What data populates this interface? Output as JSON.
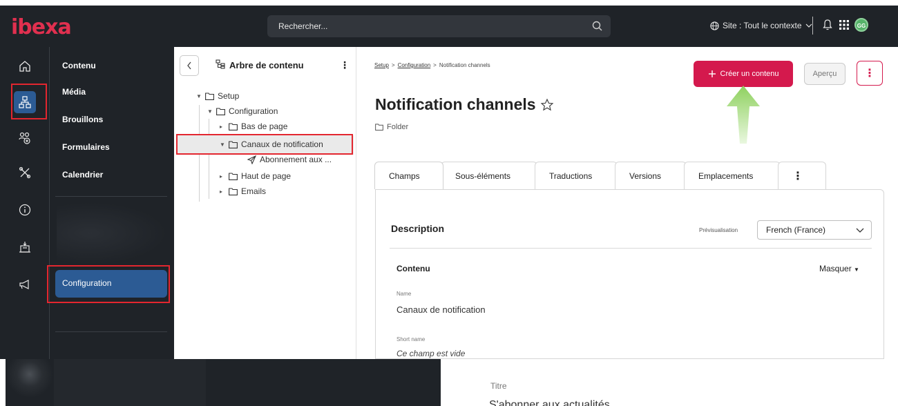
{
  "header": {
    "logo": "ibexa",
    "search_placeholder": "Rechercher...",
    "site_switch": "Site : Tout le contexte",
    "avatar_initials": "GG"
  },
  "nav": {
    "items": [
      "Contenu",
      "Média",
      "Brouillons",
      "Formulaires",
      "Calendrier"
    ],
    "active_item": "Configuration"
  },
  "tree": {
    "title": "Arbre de contenu",
    "nodes": {
      "setup": "Setup",
      "configuration": "Configuration",
      "footer": "Bas de page",
      "notification_channels": "Canaux de notification",
      "subscription": "Abonnement aux ...",
      "header": "Haut de page",
      "emails": "Emails"
    }
  },
  "breadcrumb": {
    "items": [
      "Setup",
      "Configuration",
      "Notification channels"
    ],
    "separator": ">"
  },
  "actions": {
    "create": "Créer un contenu",
    "preview": "Aperçu"
  },
  "page": {
    "title": "Notification channels",
    "content_type": "Folder"
  },
  "tabs": [
    "Champs",
    "Sous-éléments",
    "Traductions",
    "Versions",
    "Emplacements"
  ],
  "panel": {
    "title": "Description",
    "preview_label": "Prévisualisation",
    "language": "French (France)",
    "section_title": "Contenu",
    "collapse_label": "Masquer",
    "fields": {
      "name_label": "Name",
      "name_value": "Canaux de notification",
      "short_name_label": "Short name",
      "short_name_value": "Ce champ est vide"
    }
  },
  "overlay": {
    "title_label": "Titre",
    "title_value": "S'abonner aux actualités"
  },
  "colors": {
    "accent": "#d4194d",
    "brand": "#e0304f",
    "nav_active": "#2c5b94",
    "highlight_box": "#e3262f",
    "dark_bg": "#1f2328"
  }
}
